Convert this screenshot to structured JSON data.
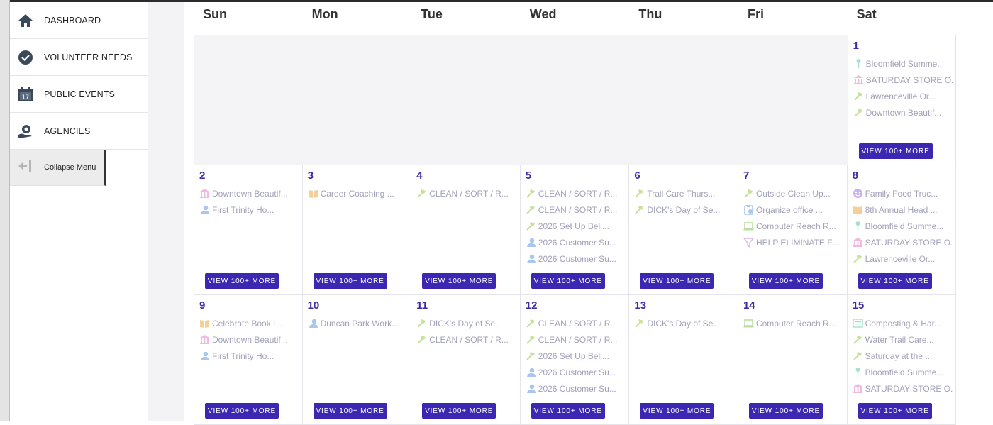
{
  "sidebar": {
    "items": [
      {
        "label": "DASHBOARD",
        "icon": "home-icon"
      },
      {
        "label": "VOLUNTEER NEEDS",
        "icon": "check-circle-icon"
      },
      {
        "label": "PUBLIC EVENTS",
        "icon": "calendar-icon"
      },
      {
        "label": "AGENCIES",
        "icon": "agency-icon"
      }
    ],
    "collapse_label": "Collapse Menu"
  },
  "calendar": {
    "days_of_week": [
      "Sun",
      "Mon",
      "Tue",
      "Wed",
      "Thu",
      "Fri",
      "Sat"
    ],
    "more_label": "VIEW 100+ MORE",
    "colors": {
      "accent": "#3c27b3",
      "day_number": "#3d2aa6",
      "event_text": "#a2a2b8"
    },
    "weeks": [
      [
        null,
        null,
        null,
        null,
        null,
        null,
        {
          "day": "1",
          "events": [
            {
              "icon": "pin-icon",
              "text": "Bloomfield Summe..."
            },
            {
              "icon": "building-icon",
              "text": "SATURDAY STORE O..."
            },
            {
              "icon": "hammer-icon",
              "text": "Lawrenceville Or..."
            },
            {
              "icon": "hammer-icon",
              "text": "Downtown Beautif..."
            }
          ]
        }
      ],
      [
        {
          "day": "2",
          "events": [
            {
              "icon": "building-icon",
              "text": "Downtown Beautif..."
            },
            {
              "icon": "person-icon",
              "text": "First Trinity Ho..."
            }
          ]
        },
        {
          "day": "3",
          "events": [
            {
              "icon": "book-icon",
              "text": "Career Coaching ..."
            }
          ]
        },
        {
          "day": "4",
          "events": [
            {
              "icon": "hammer-icon",
              "text": "CLEAN / SORT / R..."
            }
          ]
        },
        {
          "day": "5",
          "events": [
            {
              "icon": "hammer-icon",
              "text": "CLEAN / SORT / R..."
            },
            {
              "icon": "hammer-icon",
              "text": "CLEAN / SORT / R..."
            },
            {
              "icon": "hammer-icon",
              "text": "2026 Set Up Bell..."
            },
            {
              "icon": "person-icon",
              "text": "2026 Customer Su..."
            },
            {
              "icon": "person-icon",
              "text": "2026 Customer Su..."
            }
          ]
        },
        {
          "day": "6",
          "events": [
            {
              "icon": "hammer-icon",
              "text": "Trail Care Thurs..."
            },
            {
              "icon": "hammer-icon",
              "text": "DICK's Day of Se..."
            }
          ]
        },
        {
          "day": "7",
          "events": [
            {
              "icon": "hammer-icon",
              "text": "Outside Clean Up..."
            },
            {
              "icon": "clipboard-icon",
              "text": "Organize office ..."
            },
            {
              "icon": "laptop-icon",
              "text": "Computer Reach R..."
            },
            {
              "icon": "funnel-icon",
              "text": "HELP ELIMINATE F..."
            }
          ]
        },
        {
          "day": "8",
          "events": [
            {
              "icon": "food-icon",
              "text": "Family Food Truc..."
            },
            {
              "icon": "book-icon",
              "text": "8th Annual Head ..."
            },
            {
              "icon": "pin-icon",
              "text": "Bloomfield Summe..."
            },
            {
              "icon": "building-icon",
              "text": "SATURDAY STORE O..."
            },
            {
              "icon": "hammer-icon",
              "text": "Lawrenceville Or..."
            }
          ]
        }
      ],
      [
        {
          "day": "9",
          "events": [
            {
              "icon": "book-icon",
              "text": "Celebrate Book L..."
            },
            {
              "icon": "building-icon",
              "text": "Downtown Beautif..."
            },
            {
              "icon": "person-icon",
              "text": "First Trinity Ho..."
            }
          ]
        },
        {
          "day": "10",
          "events": [
            {
              "icon": "person-icon",
              "text": "Duncan Park Work..."
            }
          ]
        },
        {
          "day": "11",
          "events": [
            {
              "icon": "hammer-icon",
              "text": "DICK's Day of Se..."
            },
            {
              "icon": "hammer-icon",
              "text": "CLEAN / SORT / R..."
            }
          ]
        },
        {
          "day": "12",
          "events": [
            {
              "icon": "hammer-icon",
              "text": "CLEAN / SORT / R..."
            },
            {
              "icon": "hammer-icon",
              "text": "CLEAN / SORT / R..."
            },
            {
              "icon": "hammer-icon",
              "text": "2026 Set Up Bell..."
            },
            {
              "icon": "person-icon",
              "text": "2026 Customer Su..."
            },
            {
              "icon": "person-icon",
              "text": "2026 Customer Su..."
            }
          ]
        },
        {
          "day": "13",
          "events": [
            {
              "icon": "hammer-icon",
              "text": "DICK's Day of Se..."
            }
          ]
        },
        {
          "day": "14",
          "events": [
            {
              "icon": "laptop-icon",
              "text": "Computer Reach R..."
            }
          ]
        },
        {
          "day": "15",
          "events": [
            {
              "icon": "list-icon",
              "text": "Composting & Har..."
            },
            {
              "icon": "hammer-icon",
              "text": "Water Trail Care..."
            },
            {
              "icon": "hammer-icon",
              "text": "Saturday at the ..."
            },
            {
              "icon": "pin-icon",
              "text": "Bloomfield Summe..."
            },
            {
              "icon": "building-icon",
              "text": "SATURDAY STORE O..."
            }
          ]
        }
      ]
    ]
  }
}
